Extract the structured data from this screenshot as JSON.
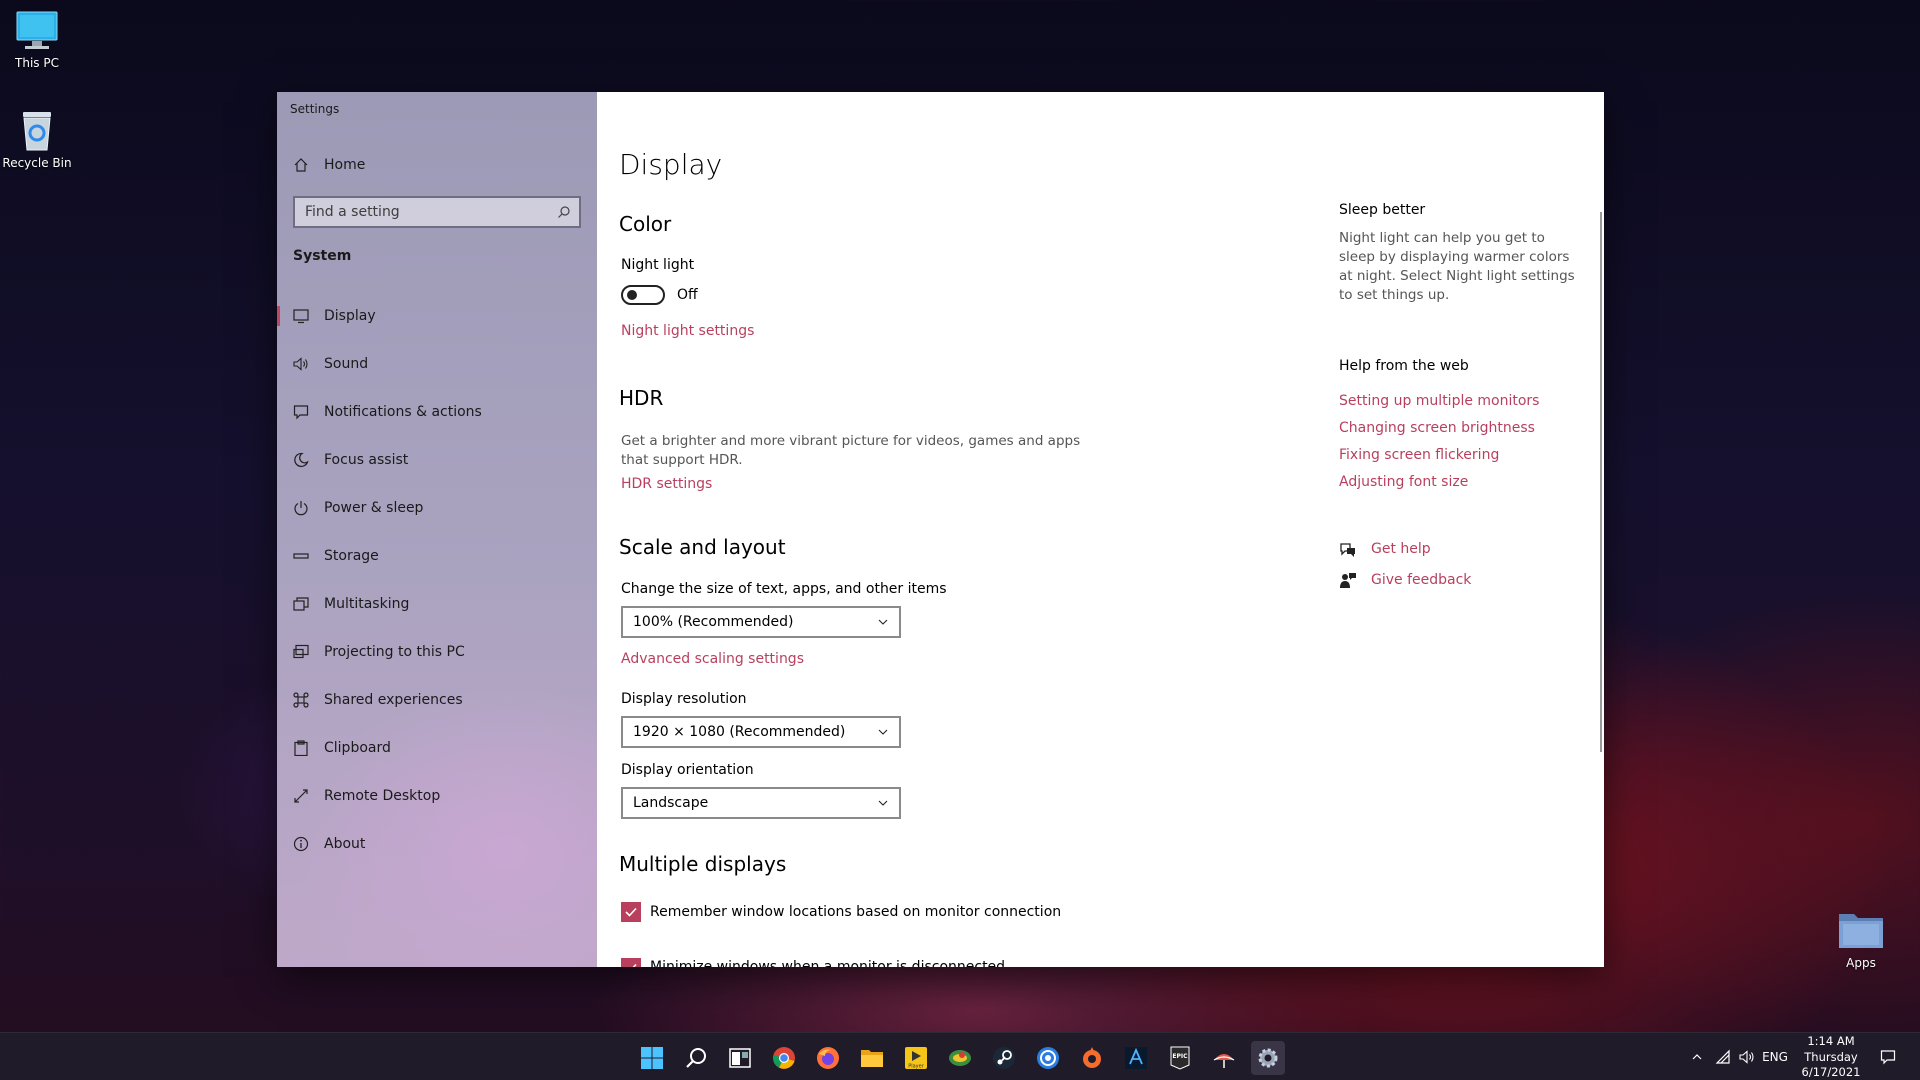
{
  "desktop": {
    "icons": [
      {
        "label": "This PC",
        "icon": "this-pc-icon"
      },
      {
        "label": "Recycle Bin",
        "icon": "recycle-bin-icon"
      },
      {
        "label": "Apps",
        "icon": "folder-icon"
      }
    ]
  },
  "window": {
    "app_title": "Settings",
    "controls": {
      "minimize": "minimize-icon",
      "maximize": "maximize-icon",
      "close": "close-icon"
    }
  },
  "sidebar": {
    "home": "Home",
    "search_placeholder": "Find a setting",
    "section": "System",
    "items": [
      {
        "label": "Display",
        "icon": "monitor-icon",
        "selected": true
      },
      {
        "label": "Sound",
        "icon": "speaker-icon"
      },
      {
        "label": "Notifications & actions",
        "icon": "notification-icon"
      },
      {
        "label": "Focus assist",
        "icon": "moon-icon"
      },
      {
        "label": "Power & sleep",
        "icon": "power-icon"
      },
      {
        "label": "Storage",
        "icon": "storage-icon"
      },
      {
        "label": "Multitasking",
        "icon": "multitasking-icon"
      },
      {
        "label": "Projecting to this PC",
        "icon": "projector-icon"
      },
      {
        "label": "Shared experiences",
        "icon": "shared-experiences-icon"
      },
      {
        "label": "Clipboard",
        "icon": "clipboard-icon"
      },
      {
        "label": "Remote Desktop",
        "icon": "remote-desktop-icon"
      },
      {
        "label": "About",
        "icon": "info-icon"
      }
    ],
    "accent": "#c24561"
  },
  "main": {
    "title": "Display",
    "color": {
      "heading": "Color",
      "night_light_label": "Night light",
      "night_light_state": "Off",
      "night_light_on": false,
      "night_light_link": "Night light settings"
    },
    "hdr": {
      "heading": "HDR",
      "description": "Get a brighter and more vibrant picture for videos, games and apps that support HDR.",
      "link": "HDR settings"
    },
    "scale": {
      "heading": "Scale and layout",
      "size_label": "Change the size of text, apps, and other items",
      "size_value": "100% (Recommended)",
      "advanced_link": "Advanced scaling settings",
      "resolution_label": "Display resolution",
      "resolution_value": "1920 × 1080 (Recommended)",
      "orientation_label": "Display orientation",
      "orientation_value": "Landscape"
    },
    "multiple": {
      "heading": "Multiple displays",
      "remember": "Remember window locations based on monitor connection",
      "minimize": "Minimize windows when a monitor is disconnected"
    }
  },
  "right": {
    "sleep_title": "Sleep better",
    "sleep_desc": "Night light can help you get to sleep by displaying warmer colors at night. Select Night light settings to set things up.",
    "web_title": "Help from the web",
    "web_links": [
      "Setting up multiple monitors",
      "Changing screen brightness",
      "Fixing screen flickering",
      "Adjusting font size"
    ],
    "get_help": "Get help",
    "give_feedback": "Give feedback"
  },
  "taskbar": {
    "apps": [
      "start-icon",
      "search-icon",
      "task-view-icon",
      "chrome-icon",
      "firefox-icon",
      "file-explorer-icon",
      "player-icon",
      "maps-icon",
      "steam-icon",
      "uplay-icon",
      "origin-icon",
      "battle-net-icon",
      "epic-games-icon",
      "weather-icon",
      "settings-icon"
    ],
    "player_label": "Player",
    "epic_label": "EPIC",
    "tray": {
      "language": "ENG"
    },
    "clock": {
      "time": "1:14 AM",
      "day": "Thursday",
      "date": "6/17/2021"
    }
  },
  "colors": {
    "accent": "#b8405e",
    "taskbar": "#1f1b29"
  }
}
